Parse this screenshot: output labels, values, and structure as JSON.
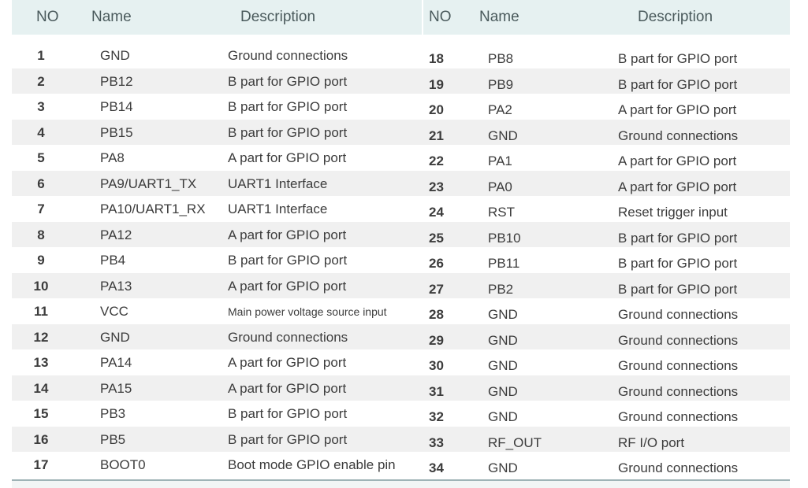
{
  "headers": {
    "left": {
      "no": "NO",
      "name": "Name",
      "description": "Description"
    },
    "right": {
      "no": "NO",
      "name": "Name",
      "description": "Description"
    }
  },
  "rows": [
    {
      "left": {
        "no": "1",
        "name": "GND",
        "desc": "Ground connections"
      },
      "right": {
        "no": "18",
        "name": "PB8",
        "desc": "B part for GPIO port"
      }
    },
    {
      "left": {
        "no": "2",
        "name": "PB12",
        "desc": "B part for GPIO port"
      },
      "right": {
        "no": "19",
        "name": "PB9",
        "desc": "B part for GPIO port"
      }
    },
    {
      "left": {
        "no": "3",
        "name": "PB14",
        "desc": "B part for GPIO port"
      },
      "right": {
        "no": "20",
        "name": "PA2",
        "desc": "A part for GPIO port"
      }
    },
    {
      "left": {
        "no": "4",
        "name": "PB15",
        "desc": "B part for GPIO port"
      },
      "right": {
        "no": "21",
        "name": "GND",
        "desc": "Ground connections"
      }
    },
    {
      "left": {
        "no": "5",
        "name": "PA8",
        "desc": "A part for GPIO port"
      },
      "right": {
        "no": "22",
        "name": "PA1",
        "desc": "A part for GPIO port"
      }
    },
    {
      "left": {
        "no": "6",
        "name": "PA9/UART1_TX",
        "desc": "UART1 Interface"
      },
      "right": {
        "no": "23",
        "name": "PA0",
        "desc": "A part for GPIO port"
      }
    },
    {
      "left": {
        "no": "7",
        "name": "PA10/UART1_RX",
        "desc": "UART1 Interface"
      },
      "right": {
        "no": "24",
        "name": "RST",
        "desc": "Reset trigger input"
      }
    },
    {
      "left": {
        "no": "8",
        "name": "PA12",
        "desc": "A part for GPIO port"
      },
      "right": {
        "no": "25",
        "name": "PB10",
        "desc": "B part for GPIO port"
      }
    },
    {
      "left": {
        "no": "9",
        "name": "PB4",
        "desc": "B part for GPIO port"
      },
      "right": {
        "no": "26",
        "name": "PB11",
        "desc": "B part for GPIO port"
      }
    },
    {
      "left": {
        "no": "10",
        "name": "PA13",
        "desc": "A part for GPIO port"
      },
      "right": {
        "no": "27",
        "name": "PB2",
        "desc": "B part for GPIO port"
      }
    },
    {
      "left": {
        "no": "11",
        "name": "VCC",
        "desc": "Main power voltage source input"
      },
      "right": {
        "no": "28",
        "name": "GND",
        "desc": "Ground connections"
      }
    },
    {
      "left": {
        "no": "12",
        "name": "GND",
        "desc": "Ground connections"
      },
      "right": {
        "no": "29",
        "name": "GND",
        "desc": "Ground connections"
      }
    },
    {
      "left": {
        "no": "13",
        "name": "PA14",
        "desc": "A part for GPIO port"
      },
      "right": {
        "no": "30",
        "name": "GND",
        "desc": "Ground connections"
      }
    },
    {
      "left": {
        "no": "14",
        "name": "PA15",
        "desc": "A part for GPIO port"
      },
      "right": {
        "no": "31",
        "name": "GND",
        "desc": "Ground connections"
      }
    },
    {
      "left": {
        "no": "15",
        "name": "PB3",
        "desc": "B part for GPIO port"
      },
      "right": {
        "no": "32",
        "name": "GND",
        "desc": "Ground connections"
      }
    },
    {
      "left": {
        "no": "16",
        "name": "PB5",
        "desc": "B part for GPIO port"
      },
      "right": {
        "no": "33",
        "name": "RF_OUT",
        "desc": "RF I/O port"
      }
    },
    {
      "left": {
        "no": "17",
        "name": "BOOT0",
        "desc": "Boot mode GPIO enable pin"
      },
      "right": {
        "no": "34",
        "name": "GND",
        "desc": "Ground connections"
      }
    }
  ]
}
